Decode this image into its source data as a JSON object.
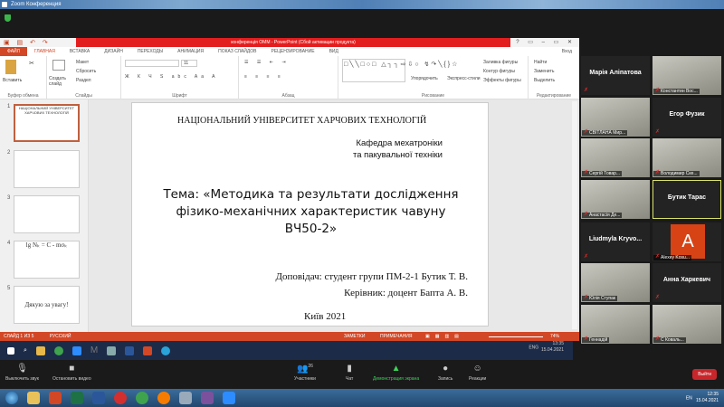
{
  "zoom_window": {
    "title": "Zoom Конференция"
  },
  "ppt": {
    "title": "конференція ОММ - PowerPoint (Сбой активации продукта)",
    "window_controls": "? ▭ – ▭ ✕",
    "tabs": [
      "ФАЙЛ",
      "ГЛАВНАЯ",
      "ВСТАВКА",
      "ДИЗАЙН",
      "ПЕРЕХОДЫ",
      "АНИМАЦИЯ",
      "ПОКАЗ СЛАЙДОВ",
      "РЕЦЕНЗИРОВАНИЕ",
      "ВИД"
    ],
    "signin": "Вход",
    "ribbon": {
      "clipboard": {
        "label": "Буфер обмена",
        "paste": "Вставить"
      },
      "slides": {
        "label": "Слайды",
        "new": "Создать слайд",
        "layout": "Макет",
        "reset": "Сбросить",
        "section": "Раздел"
      },
      "font": {
        "label": "Шрифт",
        "size": "11"
      },
      "paragraph": {
        "label": "Абзац"
      },
      "drawing": {
        "label": "Рисование",
        "arrange": "Упорядочить",
        "styles": "Экспресс-стили",
        "fill": "Заливка фигуры",
        "outline": "Контур фигуры",
        "effects": "Эффекты фигуры"
      },
      "editing": {
        "label": "Редактирование",
        "find": "Найти",
        "replace": "Заменить",
        "select": "Выделить"
      }
    },
    "thumbnails": [
      {
        "n": "1",
        "text": "НАЦІОНАЛЬНИЙ УНІВЕРСИТЕТ ХАРЧОВИХ ТЕХНОЛОГІЙ"
      },
      {
        "n": "2",
        "text": ""
      },
      {
        "n": "3",
        "text": ""
      },
      {
        "n": "4",
        "text": "lg Nₖ = C - mσₖ"
      },
      {
        "n": "5",
        "text": "Дякую за увагу!"
      }
    ],
    "slide": {
      "university": "НАЦІОНАЛЬНИЙ УНІВЕРСИТЕТ ХАРЧОВИХ ТЕХНОЛОГІЙ",
      "dept1": "Кафедра мехатроніки",
      "dept2": "та пакувальної техніки",
      "topic1": "Тема: «Методика та результати дослідження",
      "topic2": "фізико-механічних характеристик чавуну",
      "topic3": "ВЧ50-2»",
      "speaker": "Доповідач: студент групи ПМ-2-1 Бутик Т. В.",
      "supervisor": "Керівник: доцент Бапта А. В.",
      "city": "Київ 2021"
    },
    "status": {
      "slide": "СЛАЙД 1 ИЗ 5",
      "lang": "РУССКИЙ",
      "notes": "ЗАМЕТКИ",
      "comments": "ПРИМЕЧАНИЯ",
      "zoom": "74%"
    }
  },
  "inner_taskbar": {
    "lang": "ENG",
    "time": "13:35",
    "date": "15.04.2021"
  },
  "participants": [
    {
      "name": "Марія Аліпатова",
      "video": false
    },
    {
      "name": "Константин Вос...",
      "video": true
    },
    {
      "name": "СВІТЛАНА Мир...",
      "video": true
    },
    {
      "name": "Егор Фузик",
      "video": false
    },
    {
      "name": "Сергій Товар...",
      "video": true
    },
    {
      "name": "Володимир Ске...",
      "video": true
    },
    {
      "name": "Анастасія Де...",
      "video": true
    },
    {
      "name": "Бутик Тарас",
      "video": false,
      "active": true
    },
    {
      "name": "Liudmyla Kryvo...",
      "video": false
    },
    {
      "name": "Alexey Kosu...",
      "avatar": "A",
      "avatar_color": "#d84315"
    },
    {
      "name": "Юлія Ступак",
      "video": true
    },
    {
      "name": "Анна Харкевич",
      "video": false
    },
    {
      "name": "Геннадій",
      "video": true
    },
    {
      "name": "С Коваль...",
      "video": true
    }
  ],
  "zoom_controls": {
    "mute": "Выключить звук",
    "video": "Остановить видео",
    "participants": "Участники",
    "participants_count": "26",
    "chat": "Чат",
    "share": "Демонстрация экрана",
    "record": "Запись",
    "reactions": "Реакции",
    "leave": "Выйти"
  },
  "win_taskbar": {
    "lang": "EN",
    "time": "12:35",
    "date": "15.04.2021"
  }
}
